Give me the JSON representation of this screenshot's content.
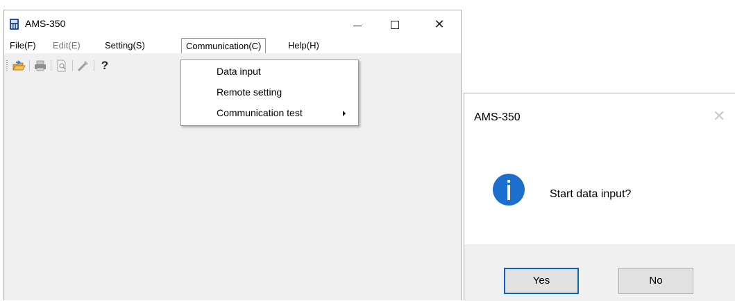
{
  "window": {
    "title": "AMS-350",
    "minimize_icon": "minimize-icon",
    "maximize_icon": "maximize-icon",
    "close_glyph": "✕"
  },
  "menubar": {
    "items": [
      {
        "label": "File(F)",
        "disabled": false
      },
      {
        "label": "Edit(E)",
        "disabled": true
      },
      {
        "label": "Setting(S)",
        "disabled": false
      },
      {
        "label": "Communication(C)",
        "disabled": false,
        "open": true
      },
      {
        "label": "Help(H)",
        "disabled": false
      }
    ]
  },
  "toolbar": {
    "icons": [
      "open-folder-icon",
      "print-icon",
      "print-preview-icon",
      "settings-tool-icon",
      "help-icon"
    ],
    "help_glyph": "?"
  },
  "dropdown": {
    "items": [
      {
        "label": "Data input",
        "submenu": false
      },
      {
        "label": "Remote setting",
        "submenu": false
      },
      {
        "label": "Communication test",
        "submenu": true
      }
    ]
  },
  "dialog": {
    "title": "AMS-350",
    "close_glyph": "✕",
    "icon": "info-icon",
    "message": "Start data input?",
    "yes_label": "Yes",
    "no_label": "No"
  },
  "colors": {
    "accent": "#0a64c8",
    "info_icon": "#1c6fcf",
    "window_bg": "#f0f0f0"
  }
}
